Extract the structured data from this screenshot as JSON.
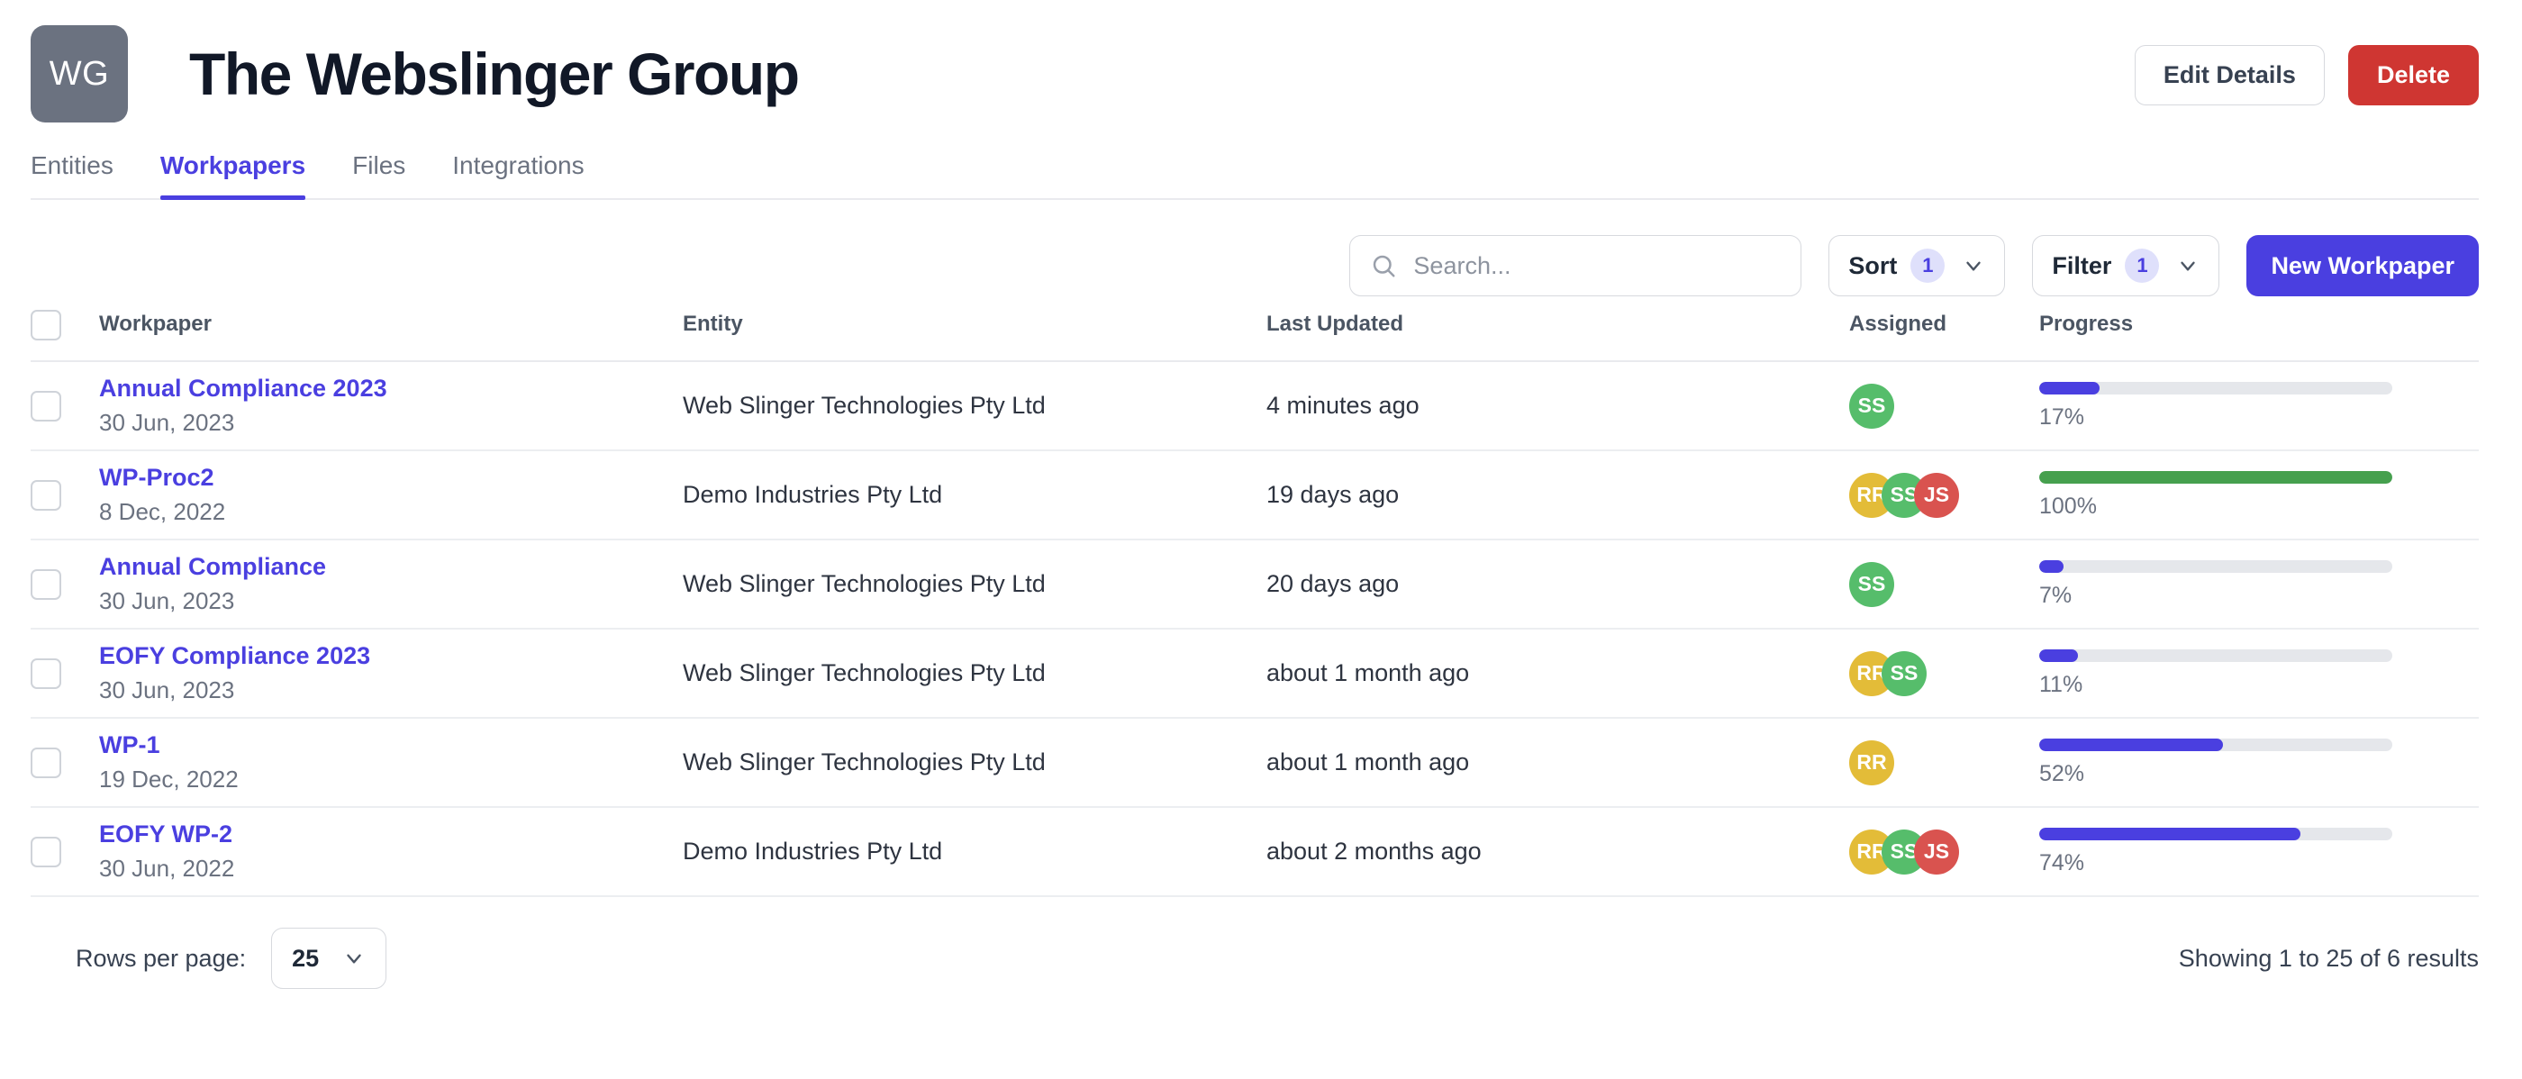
{
  "header": {
    "avatar_initials": "WG",
    "avatar_color": "#6b7280",
    "title": "The Webslinger Group",
    "edit_label": "Edit Details",
    "delete_label": "Delete",
    "delete_color": "#cf3632"
  },
  "tabs": [
    {
      "label": "Entities",
      "active": false
    },
    {
      "label": "Workpapers",
      "active": true
    },
    {
      "label": "Files",
      "active": false
    },
    {
      "label": "Integrations",
      "active": false
    }
  ],
  "accent_color": "#4a3fe0",
  "toolbar": {
    "search_placeholder": "Search...",
    "search_value": "",
    "sort_label": "Sort",
    "sort_count": "1",
    "filter_label": "Filter",
    "filter_count": "1",
    "new_label": "New Workpaper"
  },
  "table": {
    "columns": [
      "Workpaper",
      "Entity",
      "Last Updated",
      "Assigned",
      "Progress"
    ],
    "rows": [
      {
        "name": "Annual Compliance 2023",
        "date": "30 Jun, 2023",
        "entity": "Web Slinger Technologies Pty Ltd",
        "updated": "4 minutes ago",
        "assigned": [
          {
            "initials": "SS",
            "color": "#56bd6b"
          }
        ],
        "progress": 17,
        "progress_label": "17%",
        "progress_color": "#4a3fe0"
      },
      {
        "name": "WP-Proc2",
        "date": "8 Dec, 2022",
        "entity": "Demo Industries Pty Ltd",
        "updated": "19 days ago",
        "assigned": [
          {
            "initials": "RR",
            "color": "#e3bc38"
          },
          {
            "initials": "SS",
            "color": "#56bd6b"
          },
          {
            "initials": "JS",
            "color": "#d9534f"
          }
        ],
        "progress": 100,
        "progress_label": "100%",
        "progress_color": "#46a04e"
      },
      {
        "name": "Annual Compliance",
        "date": "30 Jun, 2023",
        "entity": "Web Slinger Technologies Pty Ltd",
        "updated": "20 days ago",
        "assigned": [
          {
            "initials": "SS",
            "color": "#56bd6b"
          }
        ],
        "progress": 7,
        "progress_label": "7%",
        "progress_color": "#4a3fe0"
      },
      {
        "name": "EOFY Compliance 2023",
        "date": "30 Jun, 2023",
        "entity": "Web Slinger Technologies Pty Ltd",
        "updated": "about 1 month ago",
        "assigned": [
          {
            "initials": "RR",
            "color": "#e3bc38"
          },
          {
            "initials": "SS",
            "color": "#56bd6b"
          }
        ],
        "progress": 11,
        "progress_label": "11%",
        "progress_color": "#4a3fe0"
      },
      {
        "name": "WP-1",
        "date": "19 Dec, 2022",
        "entity": "Web Slinger Technologies Pty Ltd",
        "updated": "about 1 month ago",
        "assigned": [
          {
            "initials": "RR",
            "color": "#e3bc38"
          }
        ],
        "progress": 52,
        "progress_label": "52%",
        "progress_color": "#4a3fe0"
      },
      {
        "name": "EOFY WP-2",
        "date": "30 Jun, 2022",
        "entity": "Demo Industries Pty Ltd",
        "updated": "about 2 months ago",
        "assigned": [
          {
            "initials": "RR",
            "color": "#e3bc38"
          },
          {
            "initials": "SS",
            "color": "#56bd6b"
          },
          {
            "initials": "JS",
            "color": "#d9534f"
          }
        ],
        "progress": 74,
        "progress_label": "74%",
        "progress_color": "#4a3fe0"
      }
    ]
  },
  "footer": {
    "rows_per_page_label": "Rows per page:",
    "rows_per_page_value": "25",
    "showing": "Showing 1 to 25 of 6 results"
  }
}
